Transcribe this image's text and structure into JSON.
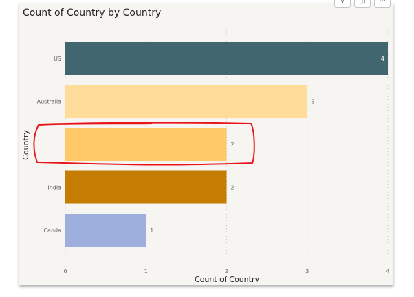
{
  "header_icons": [
    {
      "name": "filter-icon",
      "glyph": "⊽"
    },
    {
      "name": "focus-mode-icon",
      "glyph": "◫"
    },
    {
      "name": "more-options-icon",
      "glyph": "···"
    }
  ],
  "chart_data": {
    "type": "bar",
    "orientation": "horizontal",
    "title": "Count of Country by Country",
    "xlabel": "Count of Country",
    "ylabel": "Country",
    "categories": [
      "US",
      "Australia",
      "",
      "India",
      "Canda"
    ],
    "values": [
      4,
      3,
      2,
      2,
      1
    ],
    "colors": [
      "#41666f",
      "#ffdc9a",
      "#ffc868",
      "#c47d00",
      "#9eaedd"
    ],
    "xlim": [
      0,
      4
    ],
    "xticks": [
      0,
      1,
      2,
      3,
      4
    ],
    "grid": true,
    "data_labels": true,
    "annotation": {
      "type": "hand-drawn-outline",
      "color": "#e00000",
      "category_index": 2
    }
  }
}
